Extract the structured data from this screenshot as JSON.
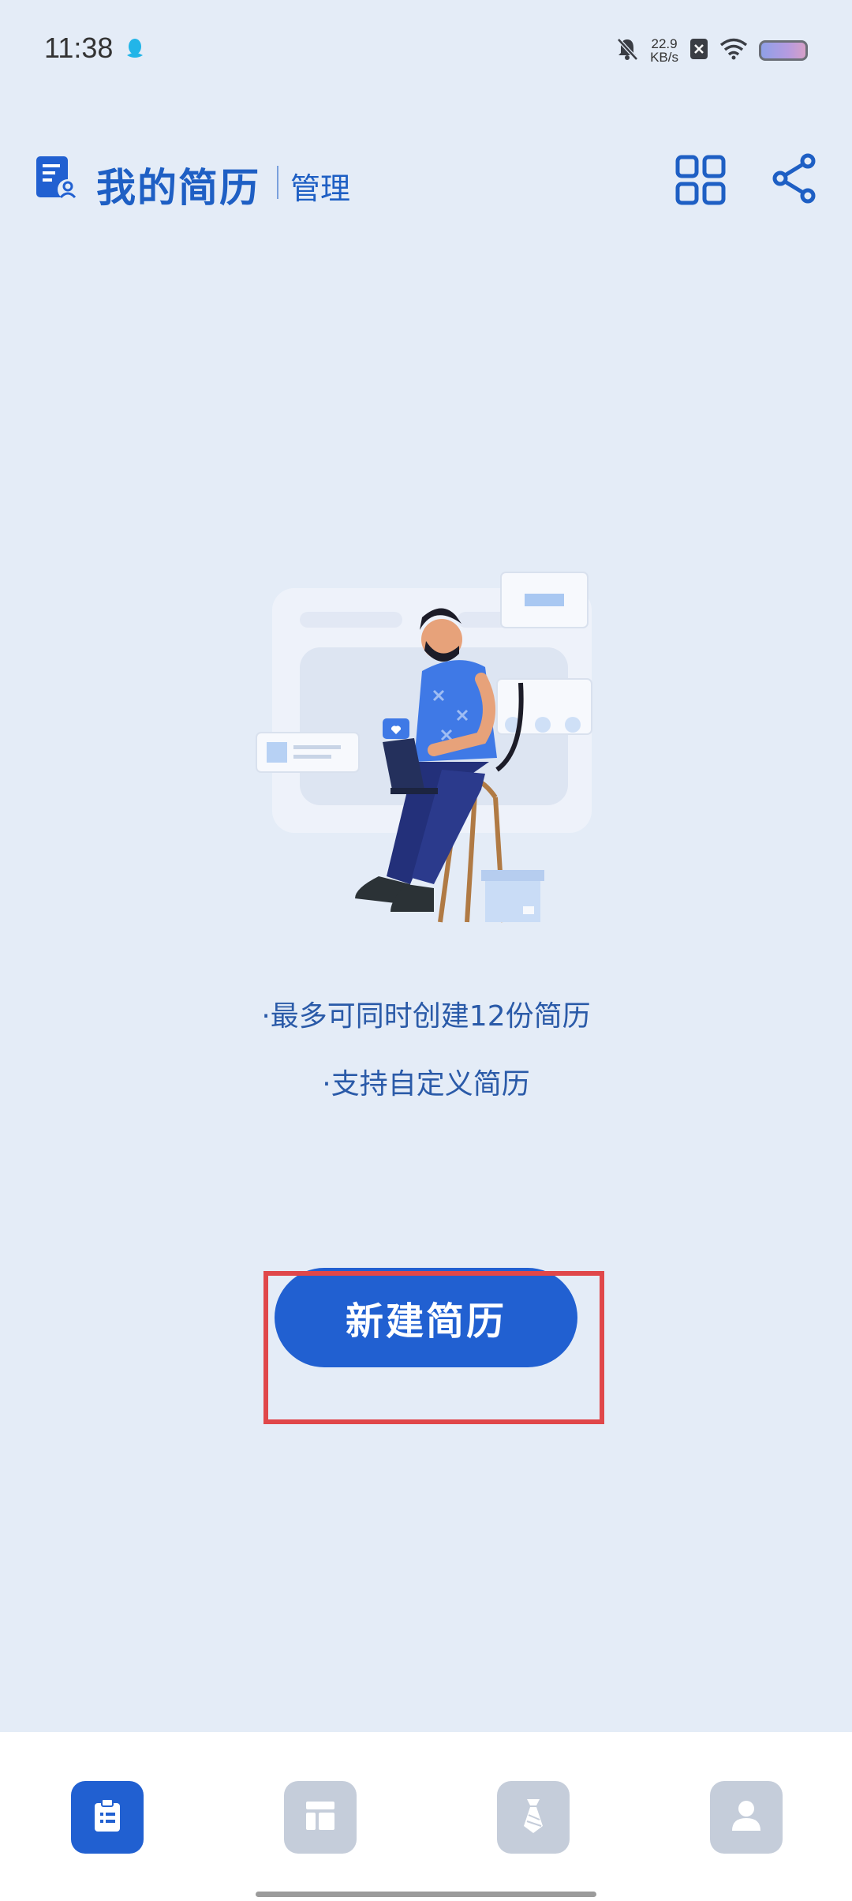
{
  "status_bar": {
    "time": "11:38",
    "net_speed_value": "22.9",
    "net_speed_unit": "KB/s",
    "icons": [
      "qq-icon",
      "mute-icon",
      "sim-off-icon",
      "wifi-icon",
      "battery-icon"
    ]
  },
  "header": {
    "title": "我的简历",
    "manage_label": "管理",
    "icons": [
      "resume-logo-icon",
      "grid-icon",
      "share-icon"
    ]
  },
  "main": {
    "features": [
      "·最多可同时创建12份简历",
      "·支持自定义简历"
    ],
    "create_button_label": "新建简历"
  },
  "bottom_nav": {
    "items": [
      {
        "icon": "clipboard-icon",
        "active": true
      },
      {
        "icon": "template-icon",
        "active": false
      },
      {
        "icon": "tie-icon",
        "active": false
      },
      {
        "icon": "user-icon",
        "active": false
      }
    ]
  },
  "colors": {
    "background": "#e4ecf7",
    "accent": "#2160d1",
    "highlight": "#e0474a",
    "nav_inactive": "#c5cdda"
  }
}
